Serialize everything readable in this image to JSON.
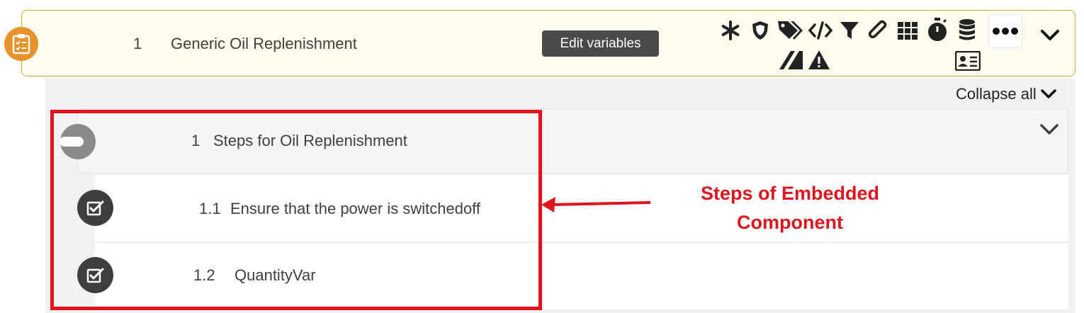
{
  "header": {
    "step_number": "1",
    "title": "Generic Oil Replenishment",
    "edit_variables_label": "Edit variables",
    "badge_icon": "clipboard-checklist-icon",
    "toolbar_icons": [
      "asterisk-icon",
      "shield-icon",
      "tags-icon",
      "code-icon",
      "filter-icon",
      "paperclip-icon",
      "grid-icon",
      "stopwatch-icon",
      "database-icon",
      "more-icon",
      "id-card-icon",
      "slash-lines-icon",
      "warning-icon"
    ],
    "accent_color": "#e8922a"
  },
  "nested": {
    "collapse_all_label": "Collapse all",
    "section": {
      "number": "1",
      "title": "Steps for Oil Replenishment"
    },
    "steps": [
      {
        "number": "1.1",
        "title": "Ensure that the power is switchedoff"
      },
      {
        "number": "1.2",
        "title": "QuantityVar"
      }
    ]
  },
  "annotation": {
    "line1": "Steps of Embedded",
    "line2": "Component",
    "color": "#e0141c"
  }
}
